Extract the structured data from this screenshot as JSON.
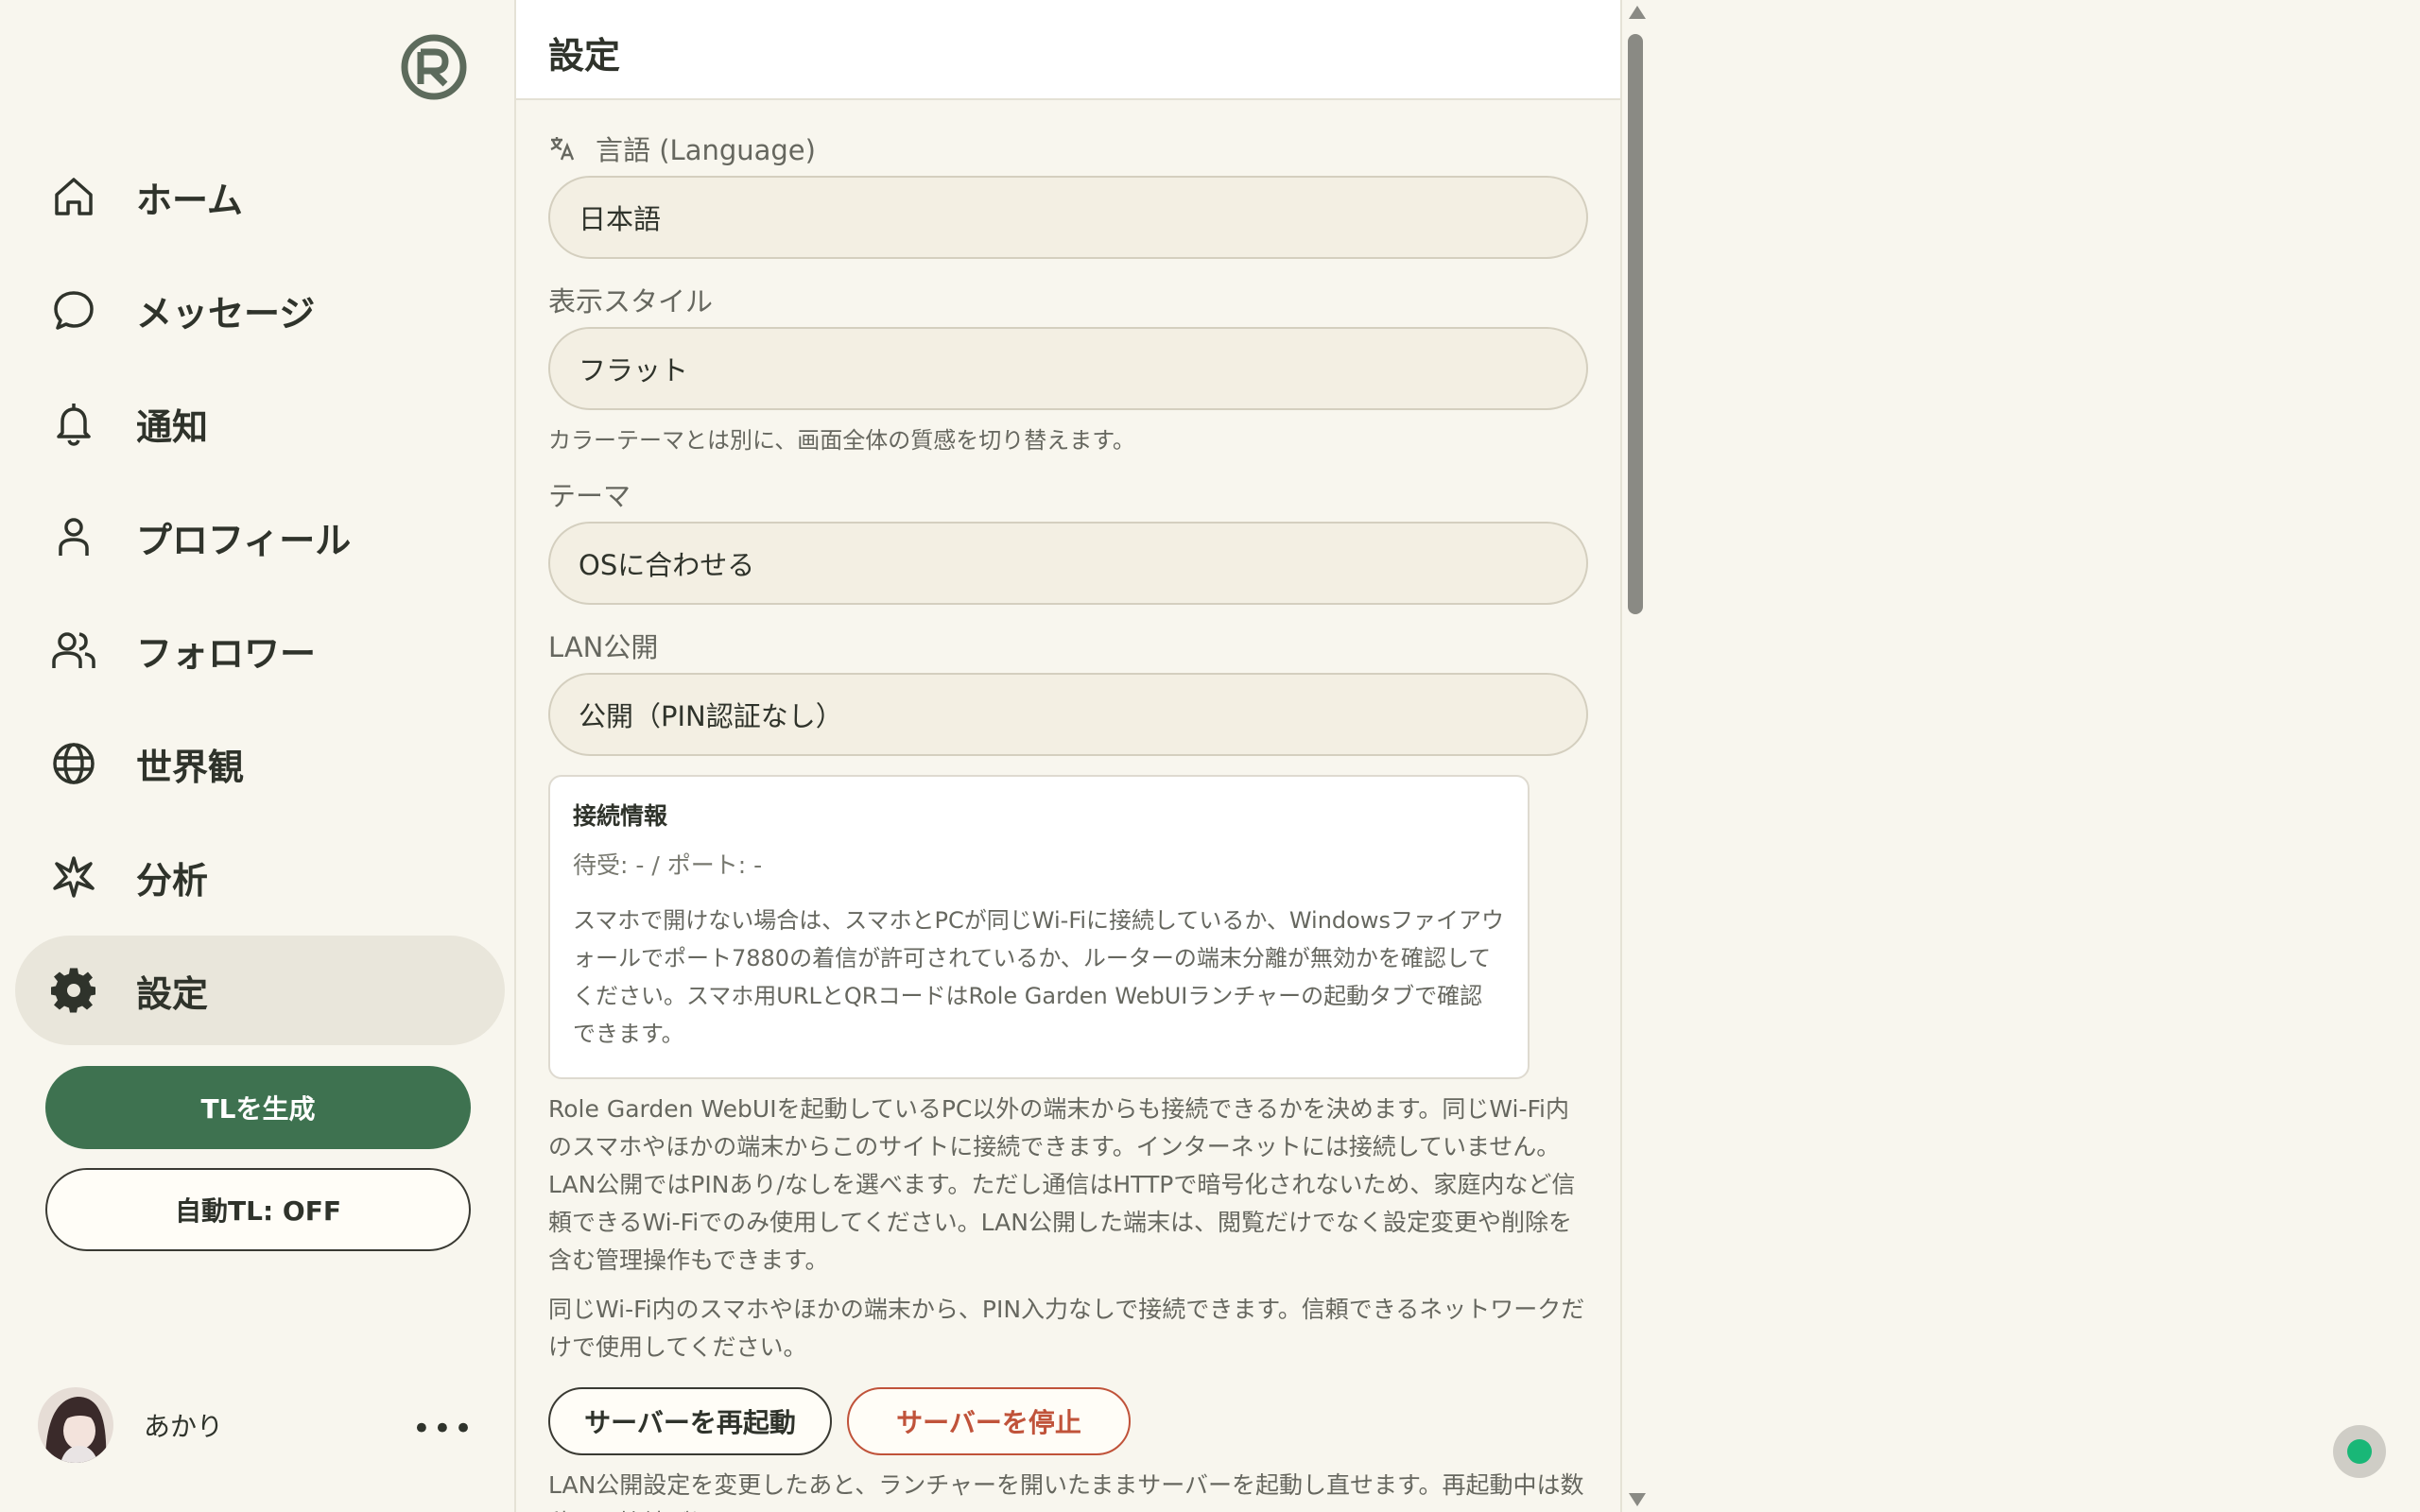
{
  "sidebar": {
    "items": [
      {
        "label": "ホーム",
        "icon": "home-icon"
      },
      {
        "label": "メッセージ",
        "icon": "chat-bubble-icon"
      },
      {
        "label": "通知",
        "icon": "bell-icon"
      },
      {
        "label": "プロフィール",
        "icon": "person-icon"
      },
      {
        "label": "フォロワー",
        "icon": "people-icon"
      },
      {
        "label": "世界観",
        "icon": "globe-icon"
      },
      {
        "label": "分析",
        "icon": "sparkle-icon"
      },
      {
        "label": "設定",
        "icon": "gear-icon",
        "active": true
      }
    ],
    "generate_button": "TLを生成",
    "auto_tl_button": "自動TL: OFF",
    "user": {
      "name": "あかり",
      "more": "•••"
    }
  },
  "main": {
    "title": "設定",
    "language": {
      "label": "言語 (Language)",
      "value": "日本語",
      "icon": "translate-icon"
    },
    "display_style": {
      "label": "表示スタイル",
      "value": "フラット",
      "hint": "カラーテーマとは別に、画面全体の質感を切り替えます。"
    },
    "theme": {
      "label": "テーマ",
      "value": "OSに合わせる"
    },
    "lan": {
      "label": "LAN公開",
      "value": "公開（PIN認証なし）"
    },
    "connection": {
      "title": "接続情報",
      "status": "待受: - / ポート: -",
      "text": "スマホで開けない場合は、スマホとPCが同じWi-Fiに接続しているか、Windowsファイアウォールでポート7880の着信が許可されているか、ルーターの端末分離が無効かを確認してください。スマホ用URLとQRコードはRole Garden WebUIランチャーの起動タブで確認できます。"
    },
    "lan_description": "Role Garden WebUIを起動しているPC以外の端末からも接続できるかを決めます。同じWi-Fi内のスマホやほかの端末からこのサイトに接続できます。インターネットには接続していません。LAN公開ではPINあり/なしを選べます。ただし通信はHTTPで暗号化されないため、家庭内など信頼できるWi-Fiでのみ使用してください。LAN公開した端末は、閲覧だけでなく設定変更や削除を含む管理操作もできます。",
    "lan_warning": "同じWi-Fi内のスマホやほかの端末から、PIN入力なしで接続できます。信頼できるネットワークだけで使用してください。",
    "restart_button": "サーバーを再起動",
    "stop_button": "サーバーを停止",
    "restart_hint": "LAN公開設定を変更したあと、ランチャーを開いたままサーバーを起動し直せます。再起動中は数秒だけ接続が切れます。"
  },
  "colors": {
    "accent": "#3e7250",
    "danger": "#c0533a",
    "status_online": "#19b777"
  }
}
